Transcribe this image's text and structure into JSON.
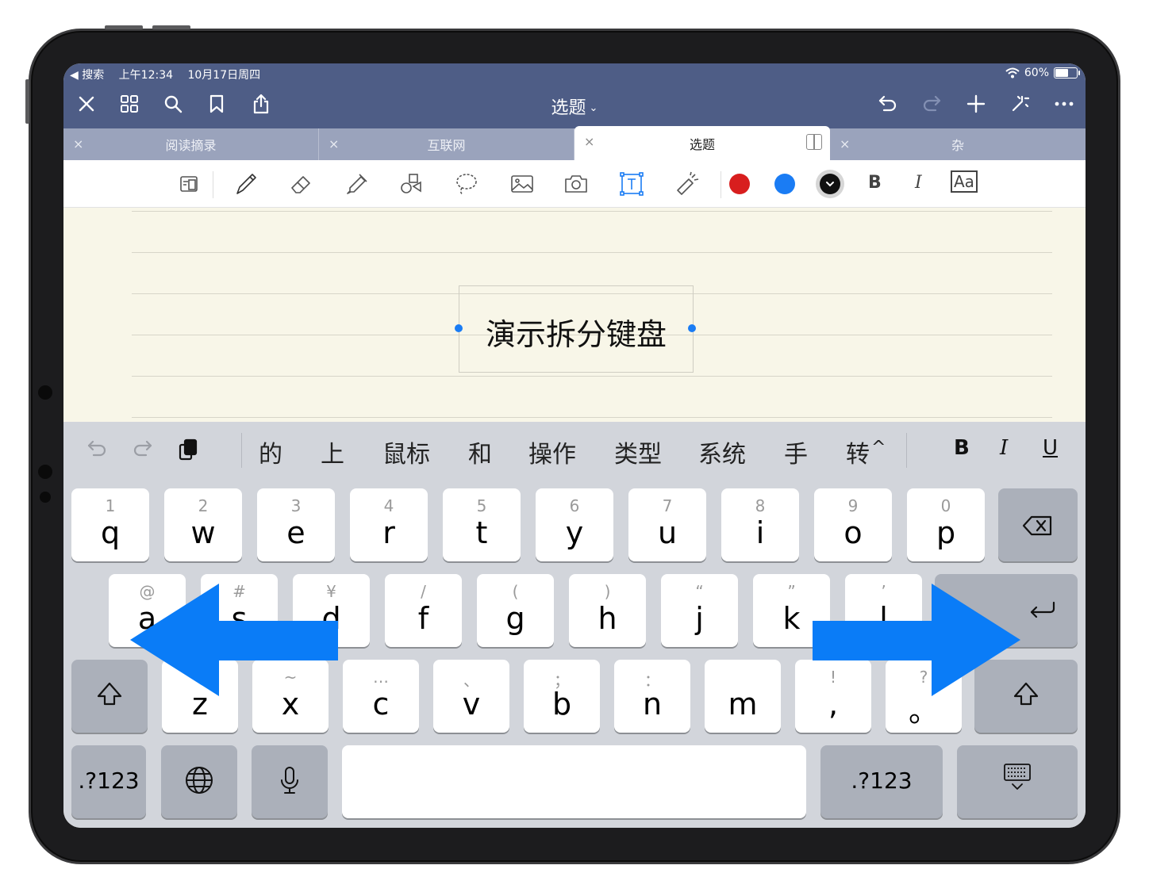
{
  "status_bar": {
    "back_label": "◀ 搜索",
    "time": "上午12:34",
    "date": "10月17日周四",
    "battery": "60%",
    "battery_level": 0.6
  },
  "nav_bar": {
    "title": "选题",
    "title_chevron": "⌄",
    "left_icons": [
      "close-icon",
      "grid-icon",
      "search-icon",
      "bookmark-icon",
      "share-icon"
    ],
    "right_icons": [
      "undo-icon",
      "redo-icon",
      "add-icon",
      "magic-icon",
      "more-icon"
    ]
  },
  "tabs": [
    {
      "label": "阅读摘录",
      "close": "×",
      "active": false
    },
    {
      "label": "互联网",
      "close": "×",
      "active": false
    },
    {
      "label": "选题",
      "close": "×",
      "active": true
    },
    {
      "label": "杂",
      "close": "×",
      "active": false
    }
  ],
  "toolbar": {
    "tools": [
      "page-switch-icon",
      "pen-icon",
      "eraser-icon",
      "highlighter-icon",
      "shapes-icon",
      "lasso-icon",
      "image-icon",
      "camera-icon",
      "text-tool-icon",
      "laser-pointer-icon"
    ],
    "selected_tool": "text-tool-icon",
    "colors": [
      "#d81e1e",
      "#1a7cf4",
      "#111111"
    ],
    "selected_color": "#111111",
    "bold": "B",
    "italic": "I",
    "font_size_label": "Aa"
  },
  "page": {
    "textbox_text": "演示拆分键盘"
  },
  "keyboard": {
    "candidate_icons": [
      "undo-icon",
      "redo-icon",
      "clipboard-icon"
    ],
    "candidates": [
      "的",
      "上",
      "鼠标",
      "和",
      "操作",
      "类型",
      "系统",
      "手",
      "转"
    ],
    "expand": "^",
    "format": {
      "bold": "B",
      "italic": "I",
      "underline": "U"
    },
    "row1": [
      {
        "hint": "1",
        "key": "q"
      },
      {
        "hint": "2",
        "key": "w"
      },
      {
        "hint": "3",
        "key": "e"
      },
      {
        "hint": "4",
        "key": "r"
      },
      {
        "hint": "5",
        "key": "t"
      },
      {
        "hint": "6",
        "key": "y"
      },
      {
        "hint": "7",
        "key": "u"
      },
      {
        "hint": "8",
        "key": "i"
      },
      {
        "hint": "9",
        "key": "o"
      },
      {
        "hint": "0",
        "key": "p"
      }
    ],
    "row2": [
      {
        "hint": "@",
        "key": "a"
      },
      {
        "hint": "#",
        "key": "s"
      },
      {
        "hint": "¥",
        "key": "d"
      },
      {
        "hint": "/",
        "key": "f"
      },
      {
        "hint": "(",
        "key": "g"
      },
      {
        "hint": ")",
        "key": "h"
      },
      {
        "hint": "“",
        "key": "j"
      },
      {
        "hint": "”",
        "key": "k"
      },
      {
        "hint": "’",
        "key": "l"
      }
    ],
    "row3": [
      {
        "hint": "-",
        "key": "z"
      },
      {
        "hint": "~",
        "key": "x"
      },
      {
        "hint": "…",
        "key": "c"
      },
      {
        "hint": "、",
        "key": "v"
      },
      {
        "hint": "；",
        "key": "b"
      },
      {
        "hint": "：",
        "key": "n"
      },
      {
        "hint": "",
        "key": "m"
      },
      {
        "hint": "!",
        "key": ","
      },
      {
        "hint": "?",
        "key": "。"
      }
    ],
    "numbers_label": ".?123",
    "space_label": ""
  },
  "annotation": {
    "arrow_color": "#0a7cf7"
  }
}
